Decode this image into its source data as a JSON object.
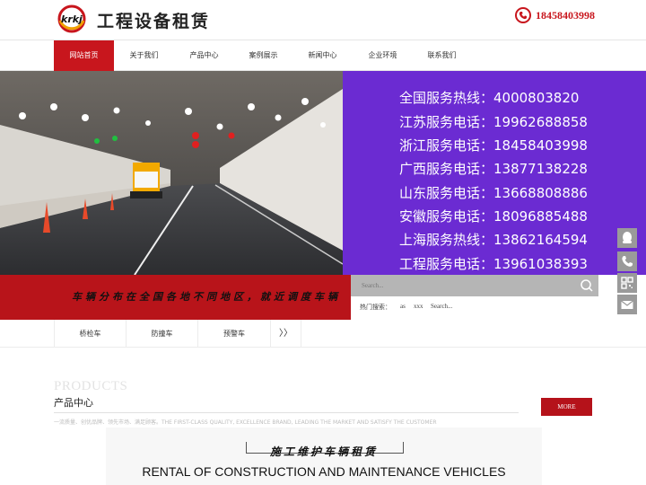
{
  "header": {
    "logo_text": "krkj",
    "brand_title": "工程设备租赁",
    "phone": "18458403998"
  },
  "nav": {
    "items": [
      {
        "label": "网站首页",
        "active": true
      },
      {
        "label": "关于我们",
        "active": false
      },
      {
        "label": "产品中心",
        "active": false
      },
      {
        "label": "案例展示",
        "active": false
      },
      {
        "label": "新闻中心",
        "active": false
      },
      {
        "label": "企业环境",
        "active": false
      },
      {
        "label": "联系我们",
        "active": false
      }
    ]
  },
  "banner": {
    "hotlines": [
      "全国服务热线：4000803820",
      "江苏服务电话：19962688858",
      "浙江服务电话：18458403998",
      "广西服务电话：13877138228",
      "山东服务电话：13668808886",
      "安徽服务电话：18096885488",
      "上海服务热线：13862164594",
      "工程服务电话：13961038393"
    ],
    "strip_text": "车辆分布在全国各地不同地区，就近调度车辆",
    "panel_color": "#6b2bd2"
  },
  "search": {
    "placeholder": "Search...",
    "hot_label": "热门搜索：",
    "hot_tags": [
      "as",
      "xxx",
      "Search..."
    ]
  },
  "categories": {
    "items": [
      "桥检车",
      "防撞车",
      "预警车"
    ],
    "more": "〉〉"
  },
  "products": {
    "title_en": "PRODUCTS",
    "title_cn": "产品中心",
    "description": "一流质量、创优品牌、领先市场、满足顾客。THE FIRST-CLASS QUALITY, EXCELLENCE BRAND, LEADING THE MARKET AND SATISFY THE CUSTOMER",
    "more_label": "MORE",
    "rental_cn": "施工维护车辆租赁",
    "rental_en": "RENTAL OF CONSTRUCTION AND MAINTENANCE VEHICLES"
  },
  "side_tools": [
    "qq-icon",
    "phone-icon",
    "qrcode-icon",
    "mail-icon"
  ],
  "colors": {
    "brand_red": "#c8161d",
    "purple": "#6b2bd2",
    "gray_tool": "#9a9a9a"
  }
}
